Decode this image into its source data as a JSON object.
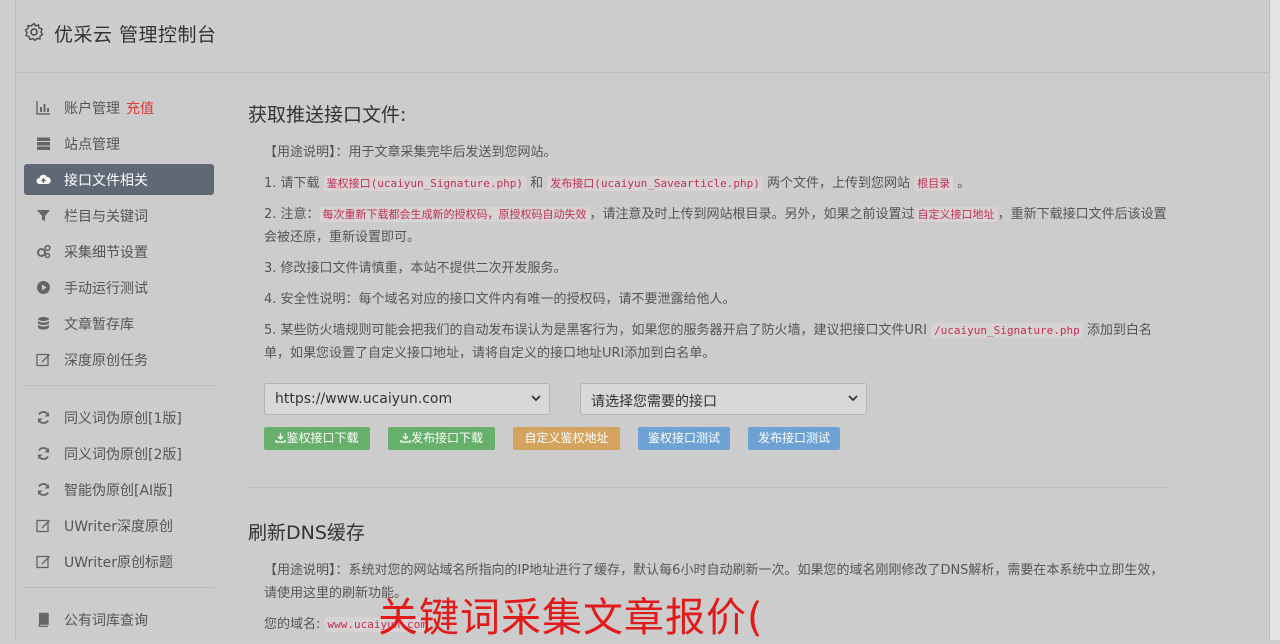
{
  "header": {
    "title": "优采云 管理控制台",
    "icon": "gear-icon"
  },
  "sidebar": {
    "items": [
      {
        "label": "账户管理",
        "badge": "充值",
        "icon": "bar-chart-icon"
      },
      {
        "label": "站点管理",
        "icon": "server-icon"
      },
      {
        "label": "接口文件相关",
        "icon": "cloud-upload-icon",
        "active": true
      },
      {
        "label": "栏目与关键词",
        "icon": "filter-icon"
      },
      {
        "label": "采集细节设置",
        "icon": "cogs-icon"
      },
      {
        "label": "手动运行测试",
        "icon": "play-circle-icon"
      },
      {
        "label": "文章暂存库",
        "icon": "database-icon"
      },
      {
        "label": "深度原创任务",
        "icon": "edit-icon"
      }
    ],
    "items2": [
      {
        "label": "同义词伪原创[1版]",
        "icon": "refresh-icon"
      },
      {
        "label": "同义词伪原创[2版]",
        "icon": "refresh-icon"
      },
      {
        "label": "智能伪原创[AI版]",
        "icon": "refresh-icon"
      },
      {
        "label": "UWriter深度原创",
        "icon": "edit-icon"
      },
      {
        "label": "UWriter原创标题",
        "icon": "edit-icon"
      }
    ],
    "items3": [
      {
        "label": "公有词库查询",
        "icon": "book-icon"
      }
    ]
  },
  "section1": {
    "title": "获取推送接口文件:",
    "usage": "【用途说明】：用于文章采集完毕后发送到您网站。",
    "p1_a": "1. 请下载 ",
    "p1_code1": "鉴权接口(ucaiyun_Signature.php)",
    "p1_b": " 和 ",
    "p1_code2": "发布接口(ucaiyun_Savearticle.php)",
    "p1_c": " 两个文件，上传到您网站 ",
    "p1_code3": "根目录",
    "p1_d": " 。",
    "p2_a": "2. 注意：",
    "p2_code1": "每次重新下载都会生成新的授权码，原授权码自动失效",
    "p2_b": "，请注意及时上传到网站根目录。另外，如果之前设置过",
    "p2_code2": "自定义接口地址",
    "p2_c": "，重新下载接口文件后该设置会被还原，重新设置即可。",
    "p3": "3. 修改接口文件请慎重，本站不提供二次开发服务。",
    "p4": "4. 安全性说明：每个域名对应的接口文件内有唯一的授权码，请不要泄露给他人。",
    "p5_a": "5. 某些防火墙规则可能会把我们的自动发布误认为是黑客行为，如果您的服务器开启了防火墙，建议把接口文件URI ",
    "p5_code": "/ucaiyun_Signature.php",
    "p5_b": " 添加到白名单，如果您设置了自定义接口地址，请将自定义的接口地址URI添加到白名单。",
    "select_site": "https://www.ucaiyun.com",
    "select_api": "请选择您需要的接口",
    "buttons": {
      "download_auth": "鉴权接口下载",
      "download_publish": "发布接口下载",
      "custom_auth": "自定义鉴权地址",
      "test_auth": "鉴权接口测试",
      "test_publish": "发布接口测试"
    }
  },
  "section2": {
    "title": "刷新DNS缓存",
    "usage": "【用途说明】：系统对您的网站域名所指向的IP地址进行了缓存，默认每6小时自动刷新一次。如果您的域名刚刚修改了DNS解析，需要在本系统中立即生效，请使用这里的刷新功能。",
    "domain_label": "您的域名:",
    "domain_value": "www.ucaiyun.com"
  },
  "overlay_text": "关键词采集文章报价("
}
